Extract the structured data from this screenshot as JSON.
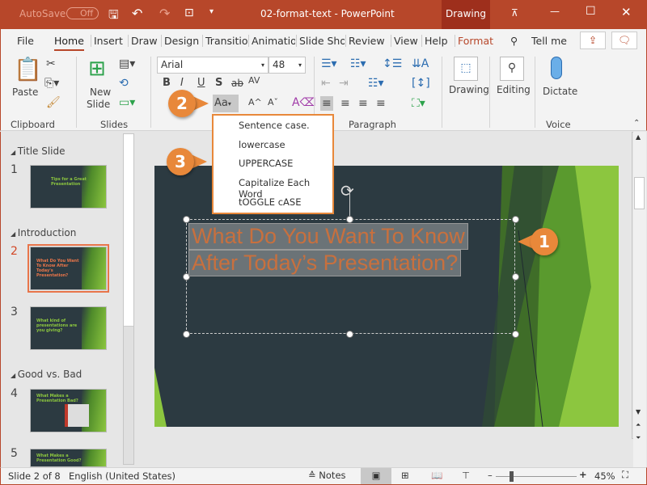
{
  "titlebar": {
    "autosave": "AutoSave",
    "autosave_state": "Off",
    "doc_title": "02-format-text  -  PowerPoint",
    "context_tab": "Drawing"
  },
  "tabs": [
    "File",
    "Home",
    "Insert",
    "Draw",
    "Design",
    "Transitio",
    "Animatio",
    "Slide Sho",
    "Review",
    "View",
    "Help",
    "Format"
  ],
  "tell_me": "Tell me",
  "ribbon": {
    "clipboard": {
      "label": "Clipboard",
      "paste": "Paste"
    },
    "slides": {
      "label": "Slides",
      "new_slide": "New",
      "new_slide2": "Slide"
    },
    "font": {
      "name": "Arial",
      "size": "48",
      "bold": "B",
      "italic": "I",
      "underline": "U",
      "shadow": "S",
      "strike": "ab",
      "spacing": "AV",
      "change_case": "Aa",
      "grow": "A^",
      "shrink": "Aˇ"
    },
    "paragraph": {
      "label": "Paragraph"
    },
    "drawing": "Drawing",
    "editing": "Editing",
    "dictate": "Dictate",
    "voice": "Voice"
  },
  "change_case_menu": [
    "Sentence case.",
    "lowercase",
    "UPPERCASE",
    "Capitalize Each Word",
    "tOGGLE cASE"
  ],
  "slide_pane": {
    "sections": [
      "Title Slide",
      "Introduction",
      "Good vs. Bad"
    ],
    "slides": [
      {
        "num": "1",
        "text": "Tips for a Great Presentation"
      },
      {
        "num": "2",
        "text": "What Do You Want To Know After Today's Presentation?"
      },
      {
        "num": "3",
        "text": "What kind of presentations are you giving?"
      },
      {
        "num": "4",
        "text": "What Makes a Presentation Bad?"
      },
      {
        "num": "5",
        "text": "What Makes a Presentation Good?"
      }
    ],
    "selected": "2"
  },
  "slide": {
    "line1": "What Do You Want To Know",
    "line2": "After Today’s Presentation?"
  },
  "callouts": [
    "1",
    "2",
    "3"
  ],
  "status": {
    "slide_of": "Slide 2 of 8",
    "language": "English (United States)",
    "notes": "Notes",
    "zoom": "45%",
    "zoom_percent": 45
  },
  "colors": {
    "accent": "#b7472a",
    "callout": "#e8883a",
    "slide_bg": "#2c3a41",
    "title_text": "#c8703e",
    "green": "#8cc63f"
  }
}
